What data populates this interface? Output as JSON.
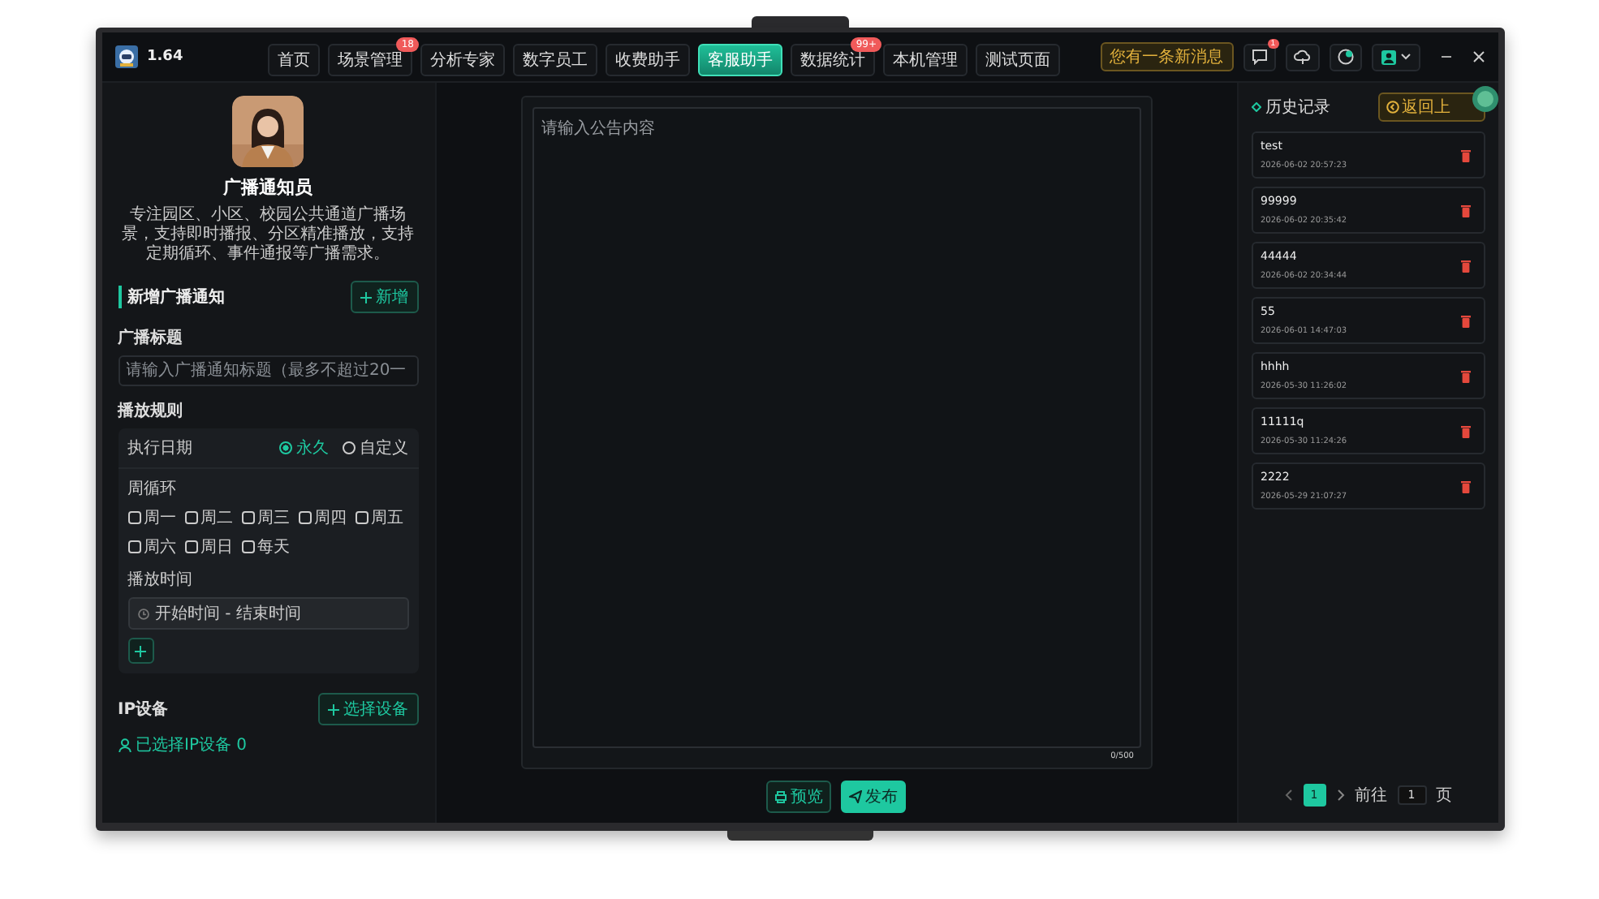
{
  "header": {
    "version": "1.64",
    "nav": [
      {
        "label": "首页",
        "selected": false
      },
      {
        "label": "场景管理",
        "selected": false,
        "badge": "18"
      },
      {
        "label": "分析专家",
        "selected": false
      },
      {
        "label": "数字员工",
        "selected": false
      },
      {
        "label": "收费助手",
        "selected": false
      },
      {
        "label": "客服助手",
        "selected": true
      },
      {
        "label": "数据统计",
        "selected": false,
        "badge": "99+"
      },
      {
        "label": "本机管理",
        "selected": false
      },
      {
        "label": "测试页面",
        "selected": false
      }
    ],
    "notice": "您有一条新消息",
    "message_badge": "1"
  },
  "agent": {
    "name": "广播通知员",
    "description": "专注园区、小区、校园公共通道广播场景，支持即时播报、分区精准播放，支持定期循环、事件通报等广播需求。"
  },
  "form": {
    "section_title": "新增广播通知",
    "add_button": "新增",
    "title_label": "广播标题",
    "title_placeholder": "请输入广播通知标题（最多不超过20一",
    "rules_label": "播放规则",
    "date_label": "执行日期",
    "date_options": [
      {
        "label": "永久",
        "selected": true
      },
      {
        "label": "自定义",
        "selected": false
      }
    ],
    "week_label": "周循环",
    "weekdays": [
      {
        "label": "周一",
        "checked": false
      },
      {
        "label": "周二",
        "checked": false
      },
      {
        "label": "周三",
        "checked": false
      },
      {
        "label": "周四",
        "checked": false
      },
      {
        "label": "周五",
        "checked": false
      },
      {
        "label": "周六",
        "checked": false
      },
      {
        "label": "周日",
        "checked": false
      },
      {
        "label": "每天",
        "checked": false
      }
    ],
    "time_label": "播放时间",
    "time_placeholder": "开始时间 - 结束时间",
    "device_label": "IP设备",
    "device_button": "选择设备",
    "device_status": "已选择IP设备 0"
  },
  "editor": {
    "placeholder": "请输入公告内容",
    "counter": "0/500",
    "preview_button": "预览",
    "publish_button": "发布"
  },
  "history": {
    "title": "历史记录",
    "back_button": "返回上",
    "items": [
      {
        "title": "test",
        "time": "2026-06-02 20:57:23"
      },
      {
        "title": "99999",
        "time": "2026-06-02 20:35:42"
      },
      {
        "title": "44444",
        "time": "2026-06-02 20:34:44"
      },
      {
        "title": "55",
        "time": "2026-06-01 14:47:03"
      },
      {
        "title": "hhhh",
        "time": "2026-05-30 11:26:02"
      },
      {
        "title": "11111q",
        "time": "2026-05-30 11:24:26"
      },
      {
        "title": "2222",
        "time": "2026-05-29 21:07:27"
      }
    ],
    "pages": [
      {
        "label": "1",
        "selected": true
      }
    ],
    "goto_label": "前往",
    "goto_value": "1",
    "page_unit": "页"
  }
}
